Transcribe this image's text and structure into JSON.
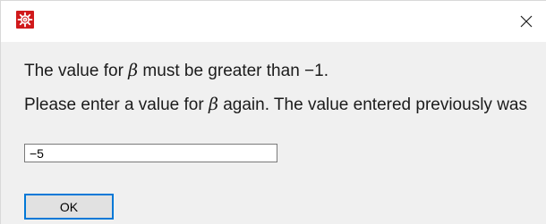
{
  "window": {
    "icon": "app-gear-icon",
    "close_glyph": "×"
  },
  "message": {
    "line1_before": "The value for ",
    "line1_symbol": "β",
    "line1_after": " must be greater than −1.",
    "line2_before": "Please enter a value for ",
    "line2_symbol": "β",
    "line2_after": " again. The value entered previously was"
  },
  "input": {
    "value": "−5"
  },
  "buttons": {
    "ok_label": "OK"
  },
  "colors": {
    "icon_background": "#d0191b",
    "focus_border": "#0078d7",
    "dialog_background": "#f0f0f0"
  }
}
